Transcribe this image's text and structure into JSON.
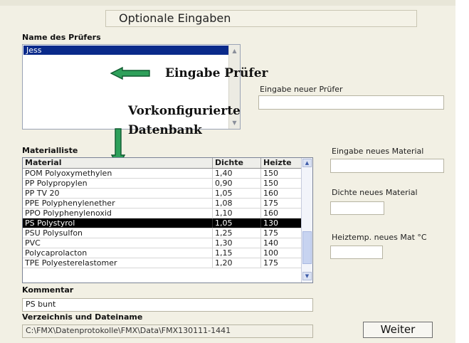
{
  "title": "Optionale Eingaben",
  "examiner": {
    "label": "Name des Prüfers",
    "items": [
      "Jess"
    ],
    "new_label": "Eingabe neuer Prüfer",
    "new_value": ""
  },
  "annotations": {
    "examiner": "Eingabe Prüfer",
    "database_line1": "Vorkonfigurierte",
    "database_line2": "Datenbank"
  },
  "material_list": {
    "label": "Materialliste",
    "columns": [
      "Material",
      "Dichte",
      "Heizte"
    ],
    "rows": [
      {
        "material": "POM   Polyoxymethylen",
        "density": "1,40",
        "heat": "150"
      },
      {
        "material": "PP   Polypropylen",
        "density": "0,90",
        "heat": "150"
      },
      {
        "material": "PP TV 20",
        "density": "1,05",
        "heat": "160"
      },
      {
        "material": "PPE Polyphenylenether",
        "density": "1,08",
        "heat": "175"
      },
      {
        "material": "PPO   Polyphenylenoxid",
        "density": "1,10",
        "heat": "160"
      },
      {
        "material": "PS   Polystyrol",
        "density": "1,05",
        "heat": "130",
        "selected": true
      },
      {
        "material": "PSU   Polysulfon",
        "density": "1,25",
        "heat": "175"
      },
      {
        "material": "PVC",
        "density": "1,30",
        "heat": "140"
      },
      {
        "material": "Polycaprolacton",
        "density": "1,15",
        "heat": "100"
      },
      {
        "material": "TPE   Polyesterelastomer",
        "density": "1,20",
        "heat": "175"
      }
    ]
  },
  "new_material": {
    "name_label": "Eingabe neues Material",
    "name_value": "",
    "density_label": "Dichte neues Material",
    "density_value": "",
    "heat_label": "Heiztemp. neues Mat °C",
    "heat_value": ""
  },
  "comment": {
    "label": "Kommentar",
    "value": "PS bunt"
  },
  "directory": {
    "label": "Verzeichnis und Dateiname",
    "value": "C:\\FMX\\Datenprotokolle\\FMX\\Data\\FMX130111-1441"
  },
  "weiter_label": "Weiter",
  "colors": {
    "panel": "#f2f0e4",
    "selection_blue": "#0a2a8a",
    "arrow_green": "#2ea05a"
  }
}
